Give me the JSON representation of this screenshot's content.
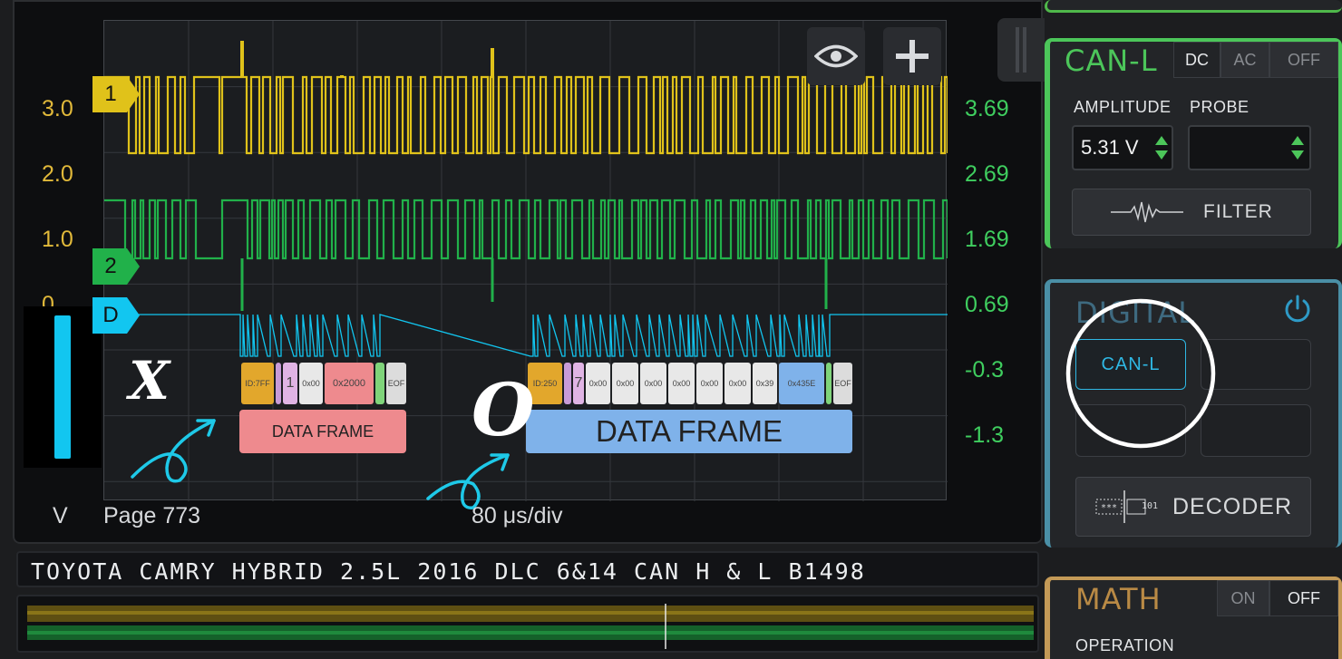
{
  "scope": {
    "left_scale": [
      "3.0",
      "2.0",
      "1.0",
      "0"
    ],
    "right_scale": [
      "3.69",
      "2.69",
      "1.69",
      "0.69",
      "-0.3",
      "-1.3"
    ],
    "channel_markers": [
      "1",
      "2",
      "D"
    ],
    "units_label": "V",
    "page_label": "Page 773",
    "timebase": "80 μs/div",
    "colors": {
      "ch1": "#e0c21a",
      "ch2": "#21b14a",
      "digital": "#12c6f0"
    }
  },
  "decode": {
    "frame1": {
      "label": "DATA FRAME",
      "cells": [
        "ID:7FF",
        "1",
        "0x00",
        "0x2000",
        "",
        "EOF"
      ]
    },
    "frame2": {
      "label": "DATA FRAME",
      "cells": [
        "ID:250",
        "7",
        "0x00",
        "0x00",
        "0x00",
        "0x00",
        "0x00",
        "0x00",
        "0x39",
        "0x435E",
        "",
        "EOF"
      ]
    }
  },
  "annotations": {
    "wrong_mark": "X",
    "right_mark": "O"
  },
  "icons": {
    "eye": "eye-icon",
    "plus": "plus-icon",
    "power": "power-icon",
    "filter": "waveform-icon",
    "decoder": "decoder-icon"
  },
  "title_bar": "TOYOTA CAMRY HYBRID 2.5L 2016 DLC 6&14 CAN H & L B1498",
  "canl_panel": {
    "title": "CAN-L",
    "coupling": [
      "DC",
      "AC",
      "OFF"
    ],
    "amplitude_label": "AMPLITUDE",
    "amplitude_value": "5.31 V",
    "probe_label": "PROBE",
    "filter_label": "FILTER"
  },
  "digital_panel": {
    "title": "DIGITAL",
    "slot_label": "CAN-L",
    "decoder_label": "DECODER",
    "decoder_icon_text": "101"
  },
  "math_panel": {
    "title": "MATH",
    "toggle": [
      "ON",
      "OFF"
    ],
    "operation_label": "OPERATION"
  }
}
